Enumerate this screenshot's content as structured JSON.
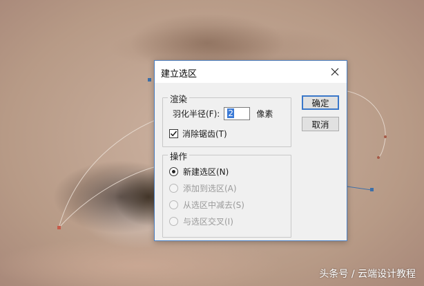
{
  "dialog": {
    "title": "建立选区",
    "feather_group": {
      "title": "渲染",
      "radius_label": "羽化半径(F):",
      "radius_value": "2",
      "unit": "像素",
      "antialias_label": "消除锯齿(T)",
      "antialias_checked": true
    },
    "operation_group": {
      "title": "操作",
      "options": [
        {
          "label": "新建选区(N)",
          "checked": true,
          "enabled": true
        },
        {
          "label": "添加到选区(A)",
          "checked": false,
          "enabled": false
        },
        {
          "label": "从选区中减去(S)",
          "checked": false,
          "enabled": false
        },
        {
          "label": "与选区交叉(I)",
          "checked": false,
          "enabled": false
        }
      ]
    },
    "buttons": {
      "ok": "确定",
      "cancel": "取消"
    }
  },
  "watermark": "头条号 / 云端设计教程",
  "colors": {
    "dialog_border": "#4a7ec1",
    "default_button_border": "#3a77c9",
    "selection_highlight": "#3b7ad6",
    "path_anchor": "#3d6fa8"
  }
}
